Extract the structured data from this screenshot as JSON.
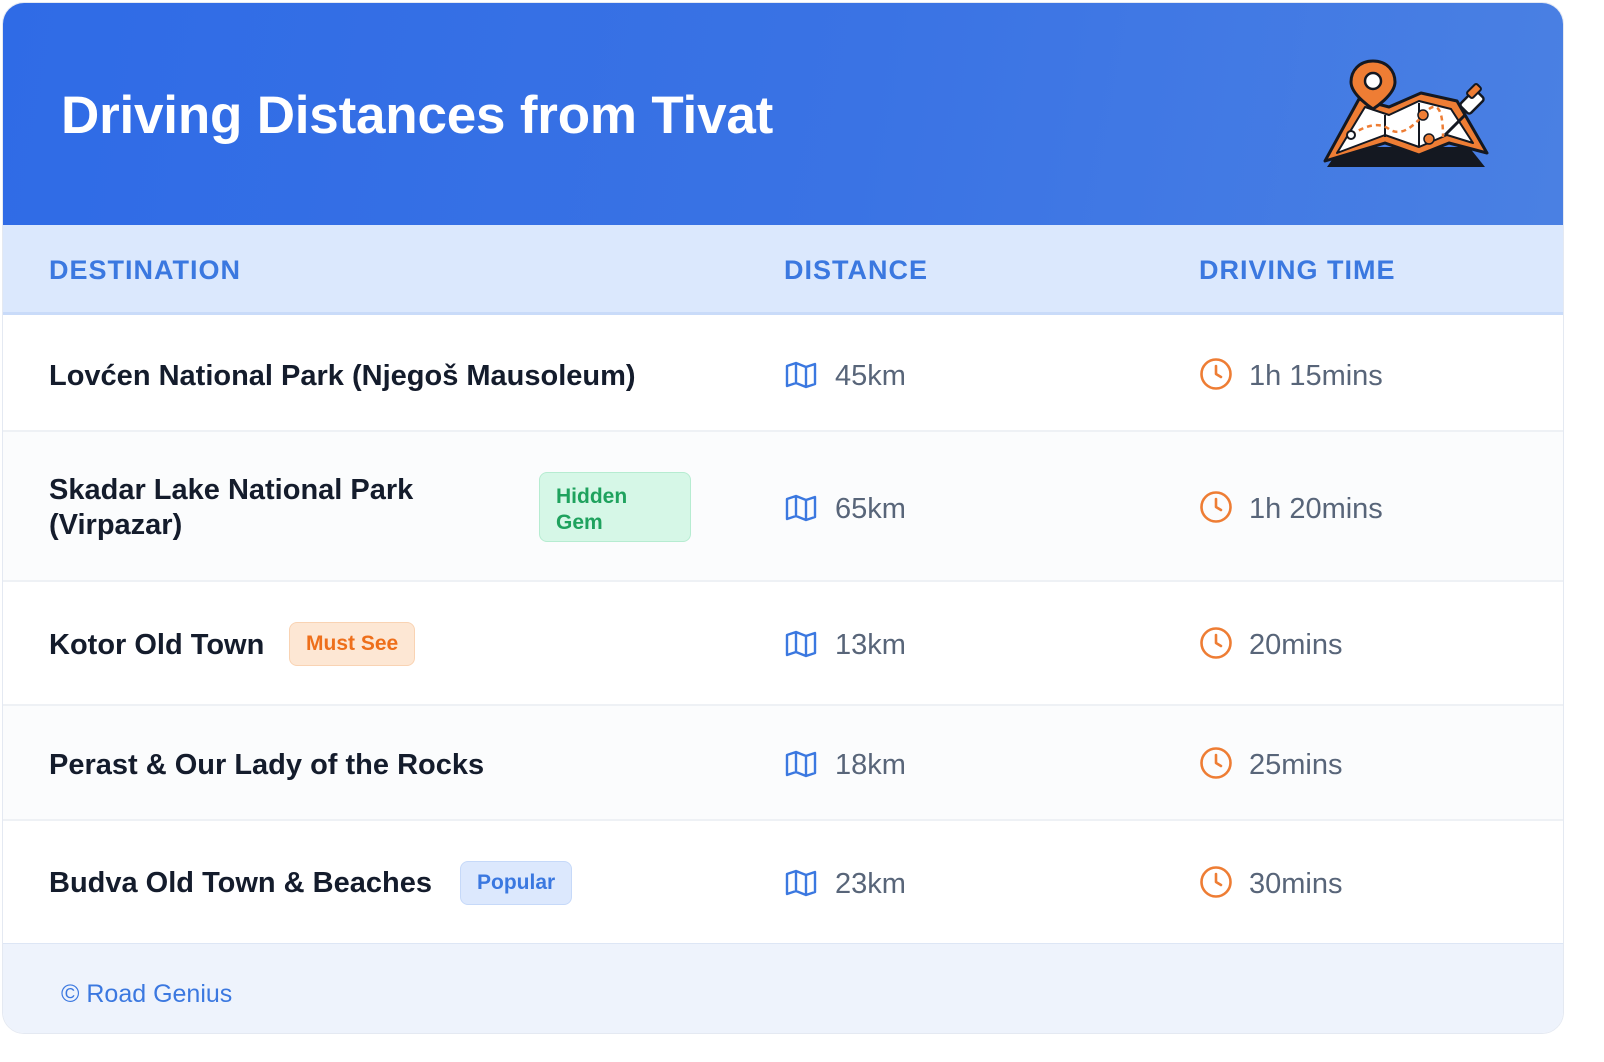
{
  "header": {
    "title": "Driving Distances from Tivat",
    "illustration_icon": "map-with-pin-icon"
  },
  "table": {
    "columns": [
      "DESTINATION",
      "DISTANCE",
      "DRIVING TIME"
    ],
    "rows": [
      {
        "destination": "Lovćen National Park (Njegoš Mausoleum)",
        "badge": "",
        "distance": "45km",
        "time": "1h 15mins"
      },
      {
        "destination": "Skadar Lake National Park (Virpazar)",
        "badge": "Hidden Gem",
        "distance": "65km",
        "time": "1h 20mins"
      },
      {
        "destination": "Kotor Old Town",
        "badge": "Must See",
        "distance": "13km",
        "time": "20mins"
      },
      {
        "destination": "Perast & Our Lady of the Rocks",
        "badge": "",
        "distance": "18km",
        "time": "25mins"
      },
      {
        "destination": "Budva Old Town & Beaches",
        "badge": "Popular",
        "distance": "23km",
        "time": "30mins"
      }
    ],
    "distance_icon": "map-icon",
    "time_icon": "clock-icon"
  },
  "footer": {
    "text": "© Road Genius"
  },
  "colors": {
    "header_bg": "#2f6be6",
    "accent_blue": "#3b78e0",
    "accent_orange": "#ee7d34",
    "green_badge": "#1fa25e"
  }
}
